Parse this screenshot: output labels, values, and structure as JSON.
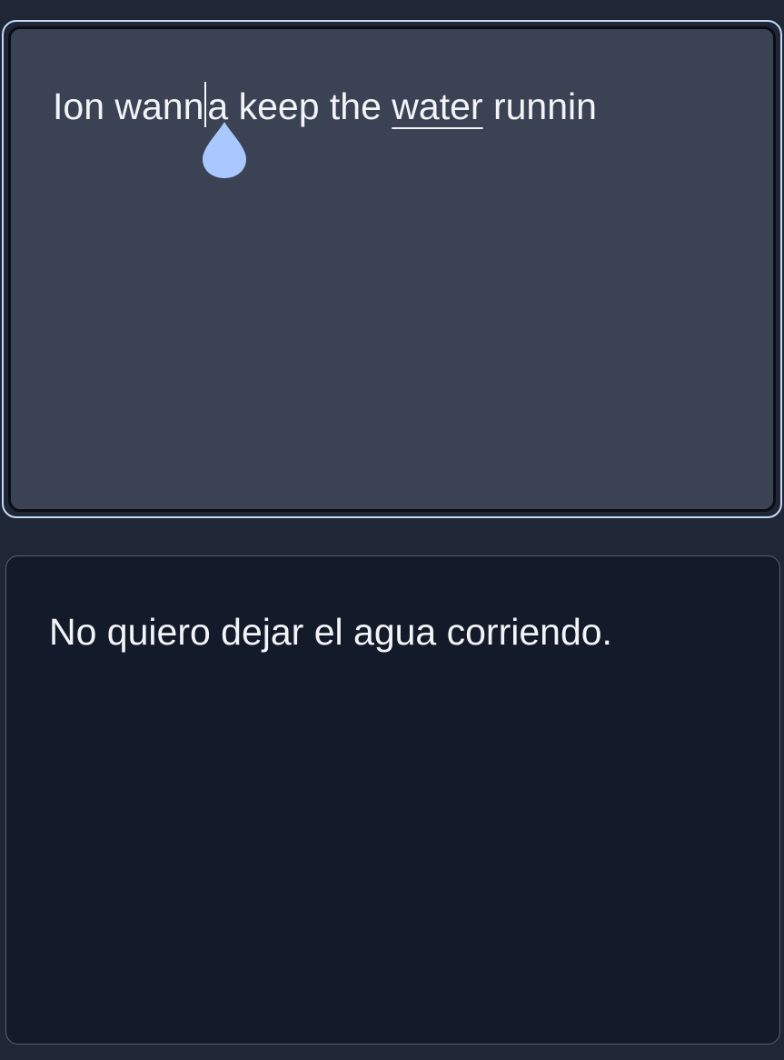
{
  "source_input": {
    "text_before_cursor": "Ion wann",
    "text_after_cursor_plain": "a keep the ",
    "underlined_word": "water",
    "text_end": " runnin"
  },
  "translation_output": {
    "text": "No quiero dejar el agua corriendo."
  },
  "colors": {
    "page_background": "#1f2737",
    "source_panel_background": "#3a4253",
    "source_panel_focus_outline": "#c3d9f4",
    "target_panel_background": "#131a29",
    "text": "#f2f4f7",
    "selection_handle": "#a9c8ff"
  },
  "icons": {
    "selection_handle": "teardrop-cursor-handle-icon"
  }
}
